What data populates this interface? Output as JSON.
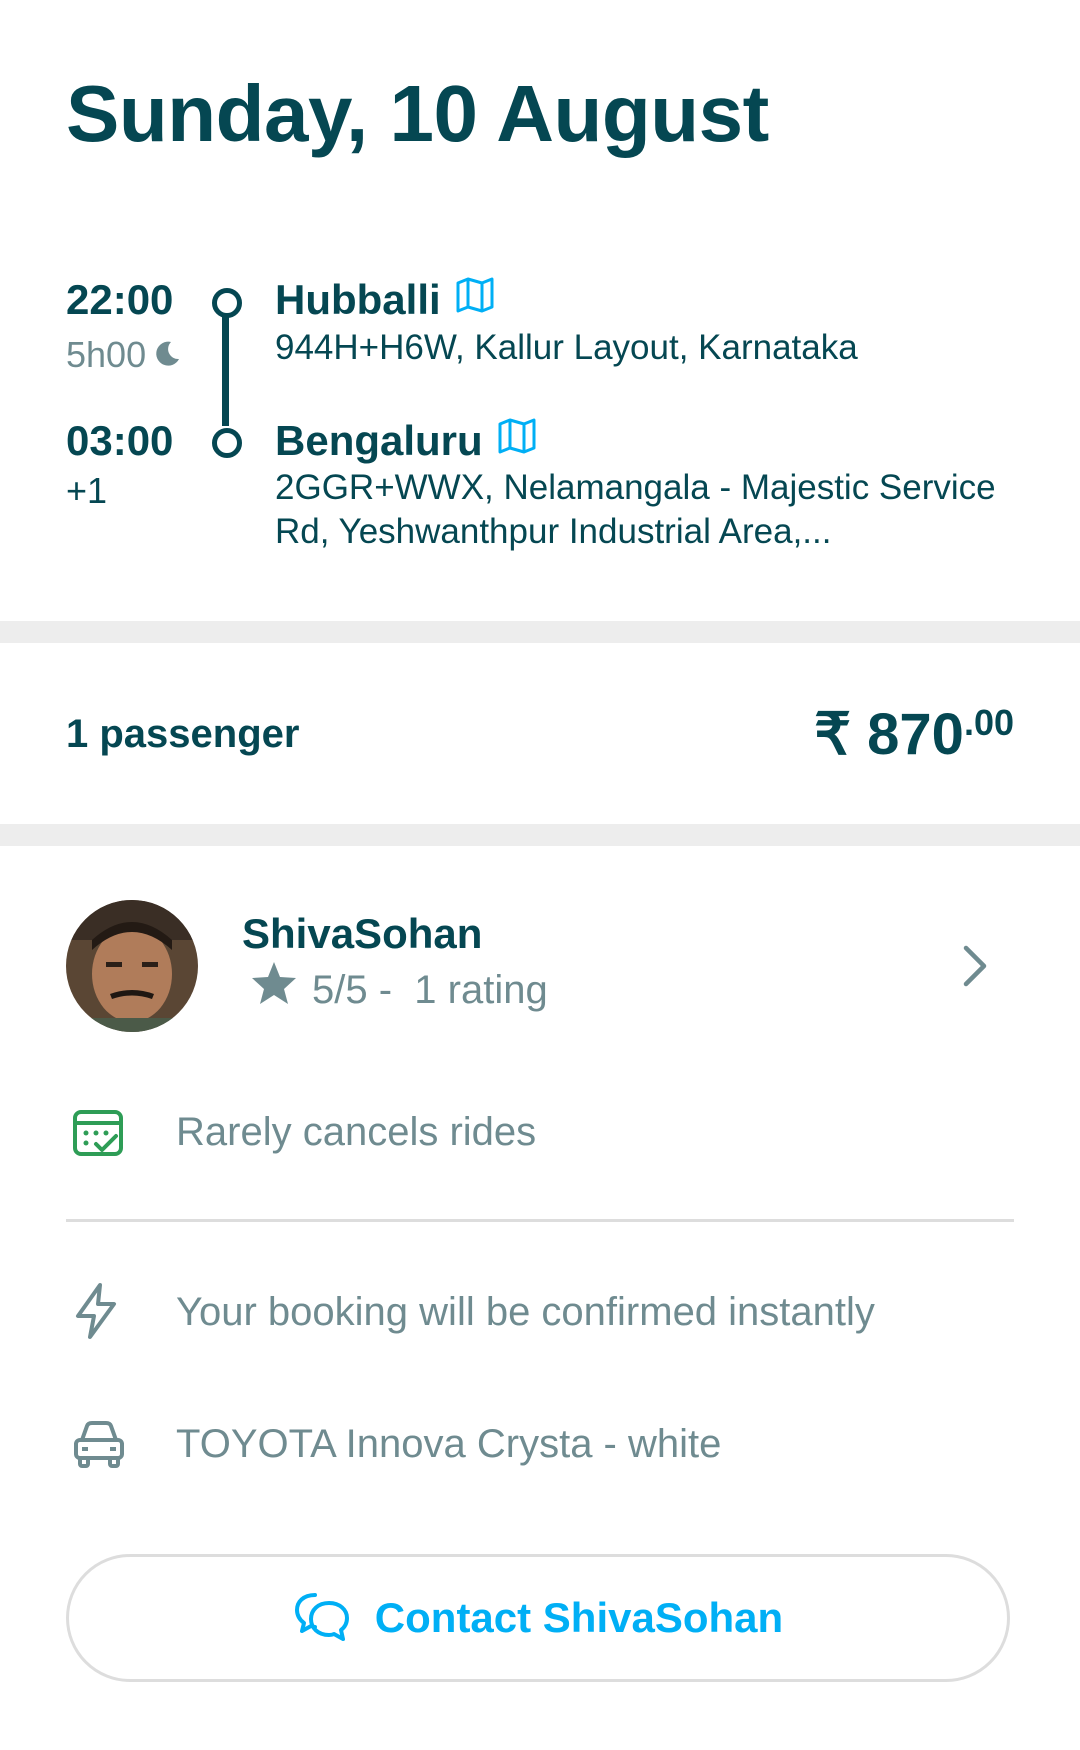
{
  "header": {
    "date": "Sunday, 10 August"
  },
  "trip": {
    "departure": {
      "time": "22:00",
      "duration": "5h00",
      "city": "Hubballi",
      "address": "944H+H6W, Kallur Layout, Karnataka"
    },
    "arrival": {
      "time": "03:00",
      "day_offset": "+1",
      "city": "Bengaluru",
      "address": "2GGR+WWX, Nelamangala - Majestic Service Rd, Yeshwanthpur Industrial Area,..."
    }
  },
  "booking": {
    "passengers": "1 passenger",
    "price_symbol": "₹",
    "price_main": "870",
    "price_decimal": ".00"
  },
  "driver": {
    "name": "ShivaSohan",
    "rating_value": "5/5 -",
    "rating_count": "1 rating"
  },
  "features": [
    {
      "icon": "calendar-check-icon",
      "label": "Rarely cancels rides"
    },
    {
      "icon": "lightning-icon",
      "label": "Your booking will be confirmed instantly"
    },
    {
      "icon": "car-icon",
      "label": "TOYOTA Innova Crysta - white"
    }
  ],
  "contact": {
    "label": "Contact ShivaSohan"
  },
  "colors": {
    "primary": "#054752",
    "accent": "#00aff5",
    "muted": "#6f8b90",
    "success": "#2e9d56",
    "divider": "#ededed"
  }
}
